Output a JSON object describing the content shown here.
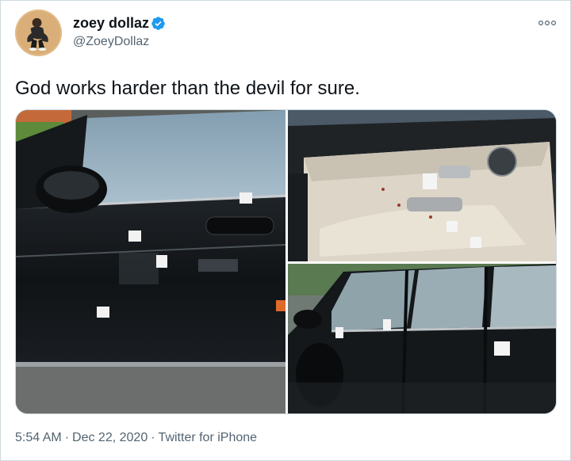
{
  "author": {
    "name": "zoey dollaz",
    "handle": "@ZoeyDollaz",
    "verified": true,
    "verified_color": "#1d9bf0"
  },
  "tweet": {
    "text": "God works harder than the devil for sure."
  },
  "meta": {
    "time": "5:54 AM",
    "separator": "·",
    "date": "Dec 22, 2020",
    "source": "Twitter for iPhone"
  },
  "icons": {
    "more": "more-options-icon",
    "verified": "verified-badge-icon"
  },
  "colors": {
    "text_primary": "#0f1419",
    "text_secondary": "#536471",
    "border": "#cfd9de"
  }
}
